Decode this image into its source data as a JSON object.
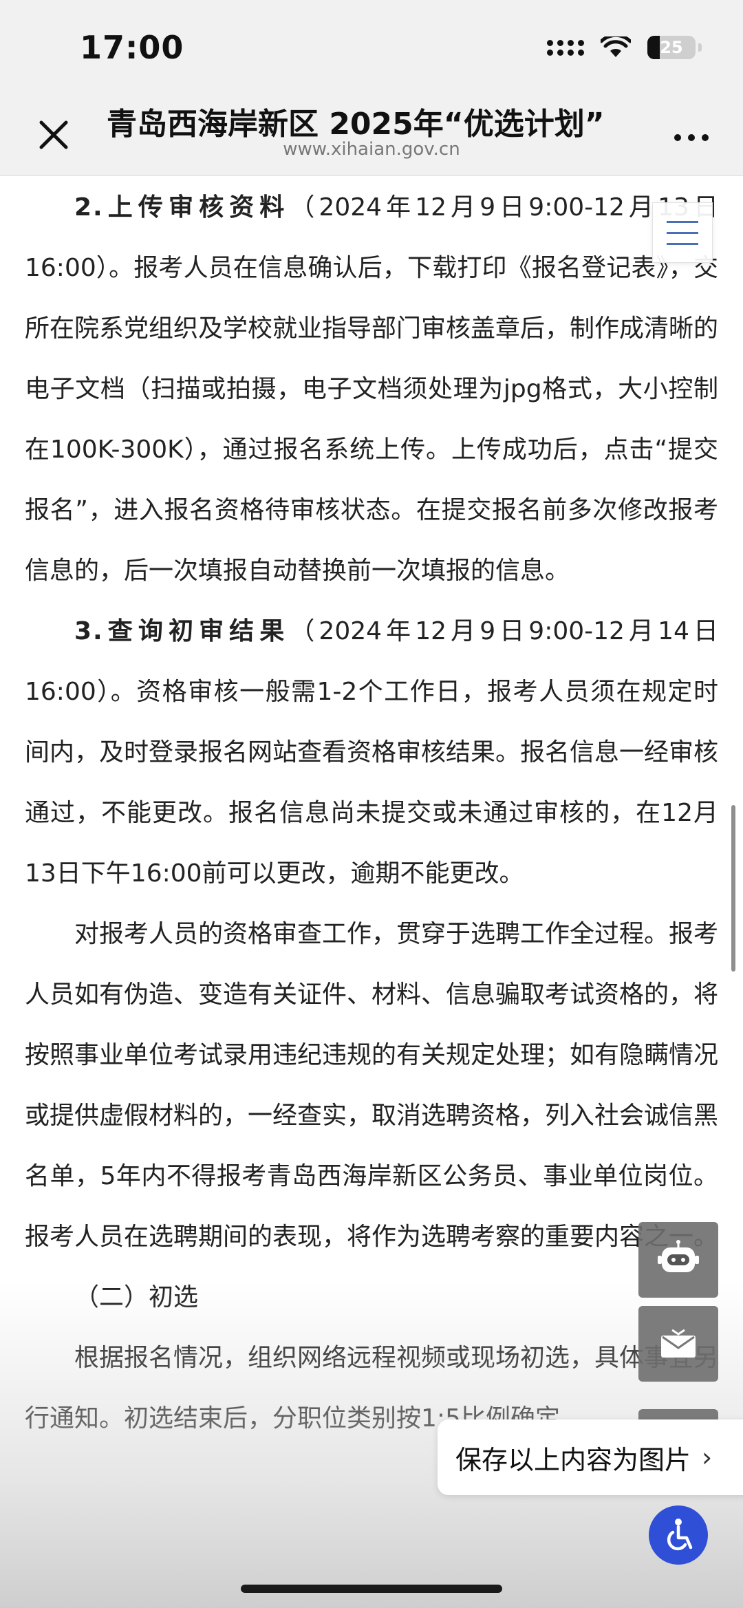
{
  "status_bar": {
    "time": "17:00",
    "battery": "25",
    "battery_level": 0.25
  },
  "header": {
    "title": "青岛西海岸新区 2025年“优选计划”",
    "url": "www.xihaian.gov.cn"
  },
  "article": {
    "p1_heading": "2.上传审核资料",
    "p1_body": "（2024年12月9日9:00-12月13日16:00）。报考人员在信息确认后，下载打印《报名登记表》，交所在院系党组织及学校就业指导部门审核盖章后，制作成清晰的电子文档（扫描或拍摄，电子文档须处理为jpg格式，大小控制在100K-300K），通过报名系统上传。上传成功后，点击“提交报名”，进入报名资格待审核状态。在提交报名前多次修改报考信息的，后一次填报自动替换前一次填报的信息。",
    "p2_heading": "3.查询初审结果",
    "p2_body": "（2024年12月9日9:00-12月14日16:00）。资格审核一般需1-2个工作日，报考人员须在规定时间内，及时登录报名网站查看资格审核结果。报名信息一经审核通过，不能更改。报名信息尚未提交或未通过审核的，在12月13日下午16:00前可以更改，逾期不能更改。",
    "p3": "对报考人员的资格审查工作，贯穿于选聘工作全过程。报考人员如有伪造、变造有关证件、材料、信息骗取考试资格的，将按照事业单位考试录用违纪违规的有关规定处理；如有隐瞒情况或提供虚假材料的，一经查实，取消选聘资格，列入社会诚信黑名单，5年内不得报考青岛西海岸新区公务员、事业单位岗位。报考人员在选聘期间的表现，将作为选聘考察的重要内容之一。",
    "p4": "（二）初选",
    "p5": "根据报名情况，组织网络远程视频或现场初选，具体事宜另行通知。初选结束后，分职位类别按1:5比例确定"
  },
  "floating": {
    "save_label": "保存以上内容为图片"
  },
  "colors": {
    "accessibility": "#2f4fd6",
    "menu_icon": "#4a6fb5"
  }
}
